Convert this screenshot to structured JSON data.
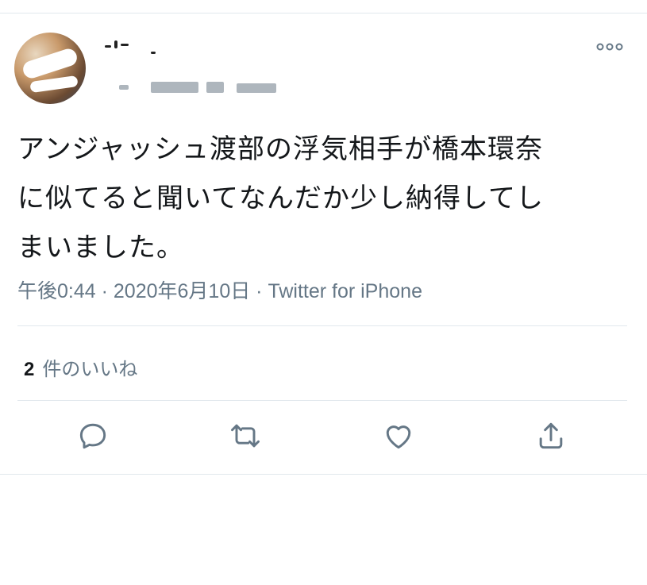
{
  "tweet": {
    "text": "アンジャッシュ渡部の浮気相手が橋本環奈\nに似てると聞いてなんだか少し納得してし\nまいました。",
    "time": "午後0:44",
    "date": "2020年6月10日",
    "source": "Twitter for iPhone",
    "separator": " · "
  },
  "engagement": {
    "like_count": "2",
    "like_label": "件のいいね"
  },
  "icons": {
    "more": "more-icon",
    "reply": "reply-icon",
    "retweet": "retweet-icon",
    "like": "like-icon",
    "share": "share-icon"
  },
  "colors": {
    "text": "#14171a",
    "secondary": "#657786",
    "divider": "#e1e8ed",
    "background": "#ffffff"
  }
}
